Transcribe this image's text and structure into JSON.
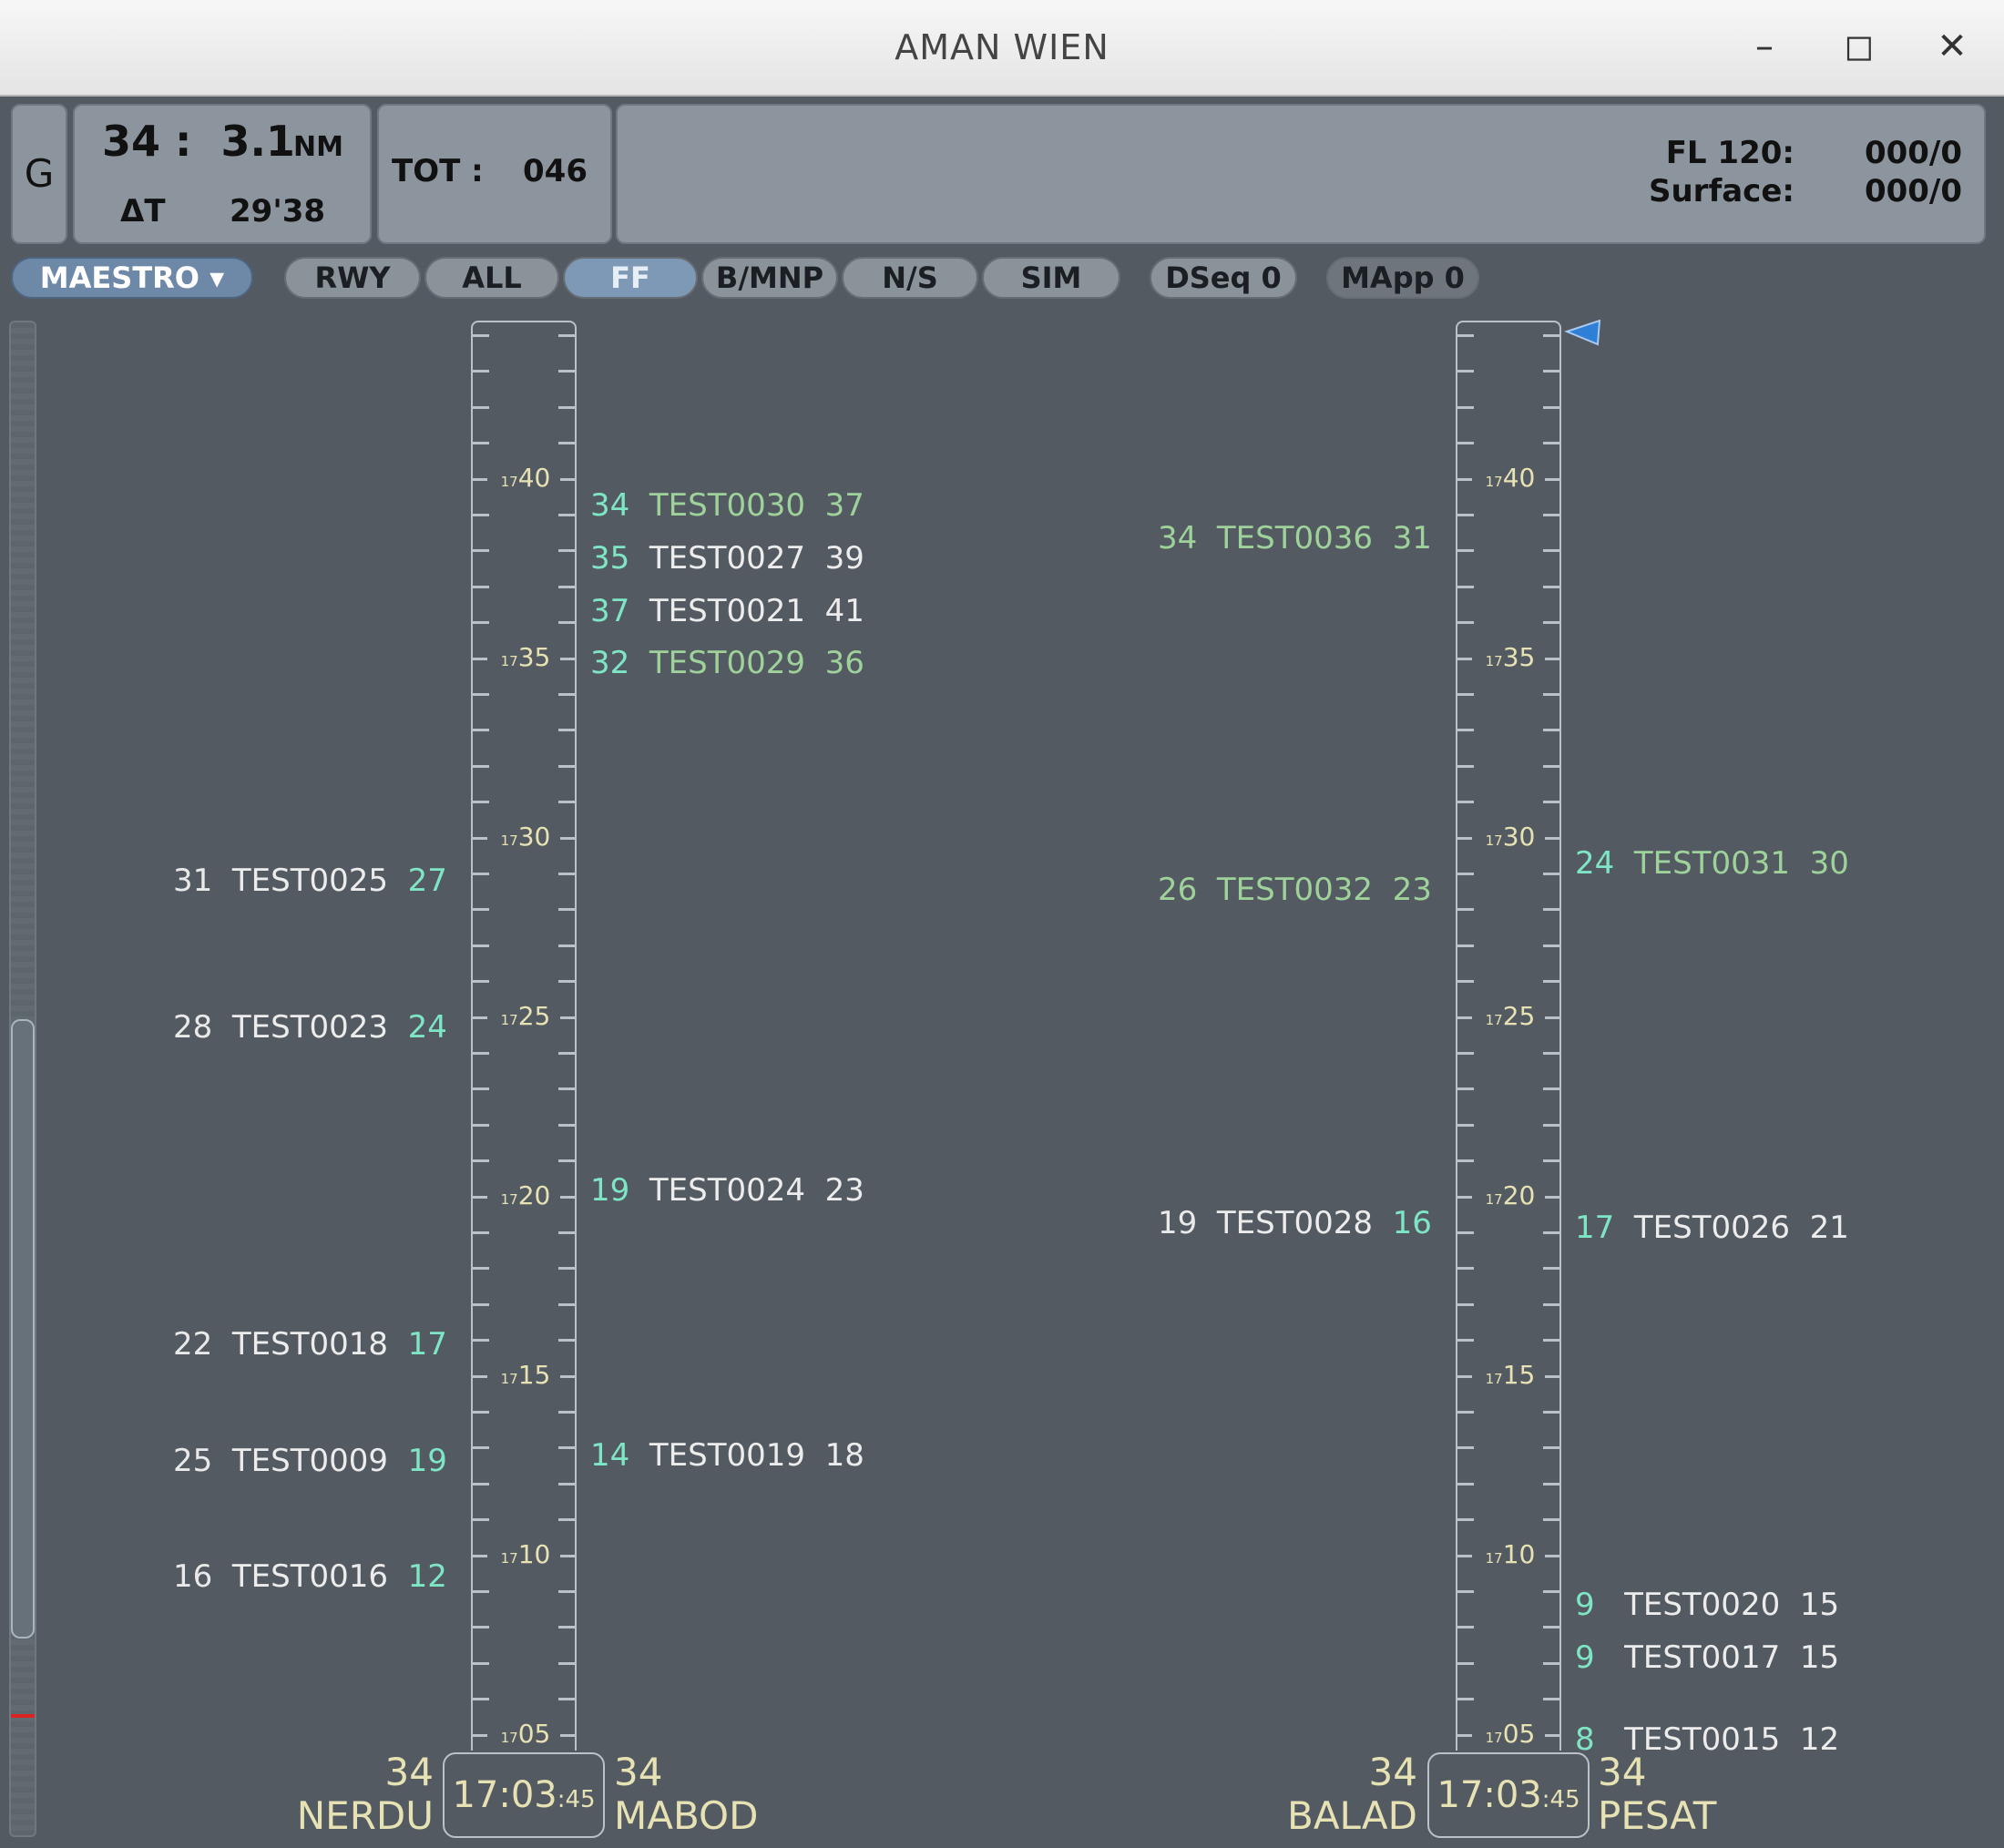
{
  "window": {
    "title": "AMAN WIEN",
    "minimize": "–",
    "maximize": "◻",
    "close": "✕"
  },
  "header": {
    "g_label": "G",
    "distance": {
      "value": "34 :  3.1",
      "unit": "NM"
    },
    "delta": {
      "label": "ΔT",
      "value": "29'38"
    },
    "tot": {
      "label": "TOT :",
      "value": "046"
    },
    "fl": {
      "label": "FL 120:",
      "value": "000/0"
    },
    "surface": {
      "label": "Surface:",
      "value": "000/0"
    }
  },
  "toolbar": {
    "maestro": "MAESTRO ▾",
    "buttons": [
      "RWY",
      "ALL",
      "FF",
      "B/MNP",
      "N/S",
      "SIM"
    ],
    "dseq": "DSeq 0",
    "mapp": "MApp 0"
  },
  "timeline_labels": {
    "minutes": [
      "40",
      "35",
      "30",
      "25",
      "20",
      "15",
      "10",
      "05"
    ],
    "hour": "17"
  },
  "columns": [
    {
      "left_rwy": "34",
      "left_fix": "NERDU",
      "time": "17:03",
      "seconds": ":45",
      "right_rwy": "34",
      "right_fix": "MABOD"
    },
    {
      "left_rwy": "34",
      "left_fix": "BALAD",
      "time": "17:03",
      "seconds": ":45",
      "right_rwy": "34",
      "right_fix": "PESAT"
    }
  ],
  "flights": [
    {
      "callsign": "TEST0025",
      "pre": "31",
      "post": "27",
      "colors": [
        "#e9e9e9",
        "#ececec",
        "#7ee6c4"
      ]
    },
    {
      "callsign": "TEST0023",
      "pre": "28",
      "post": "24",
      "colors": [
        "#e9e9e9",
        "#ececec",
        "#7ee6c4"
      ]
    },
    {
      "callsign": "TEST0018",
      "pre": "22",
      "post": "17",
      "colors": [
        "#e9e9e9",
        "#ececec",
        "#7ee6c4"
      ]
    },
    {
      "callsign": "TEST0009",
      "pre": "25",
      "post": "19",
      "colors": [
        "#e9e9e9",
        "#ececec",
        "#7ee6c4"
      ]
    },
    {
      "callsign": "TEST0016",
      "pre": "16",
      "post": "12",
      "colors": [
        "#e9e9e9",
        "#ececec",
        "#7ee6c4"
      ]
    },
    {
      "callsign": "TEST0030",
      "pre": "34",
      "post": "37",
      "colors": [
        "#7ee6c4",
        "#9ed29a",
        "#9ed29a"
      ]
    },
    {
      "callsign": "TEST0027",
      "pre": "35",
      "post": "39",
      "colors": [
        "#7ee6c4",
        "#ececec",
        "#ececec"
      ]
    },
    {
      "callsign": "TEST0021",
      "pre": "37",
      "post": "41",
      "colors": [
        "#7ee6c4",
        "#ececec",
        "#ececec"
      ]
    },
    {
      "callsign": "TEST0029",
      "pre": "32",
      "post": "36",
      "colors": [
        "#7ee6c4",
        "#9ed29a",
        "#9ed29a"
      ]
    },
    {
      "callsign": "TEST0024",
      "pre": "19",
      "post": "23",
      "colors": [
        "#7ee6c4",
        "#ececec",
        "#ececec"
      ]
    },
    {
      "callsign": "TEST0019",
      "pre": "14",
      "post": "18",
      "colors": [
        "#7ee6c4",
        "#ececec",
        "#ececec"
      ]
    },
    {
      "callsign": "TEST0036",
      "pre": "34",
      "post": "31",
      "colors": [
        "#9ed29a",
        "#9ed29a",
        "#9ed29a"
      ]
    },
    {
      "callsign": "TEST0032",
      "pre": "26",
      "post": "23",
      "colors": [
        "#9ed29a",
        "#9ed29a",
        "#9ed29a"
      ]
    },
    {
      "callsign": "TEST0028",
      "pre": "19",
      "post": "16",
      "colors": [
        "#e9e9e9",
        "#ececec",
        "#7ee6c4"
      ]
    },
    {
      "callsign": "TEST0031",
      "pre": "24",
      "post": "30",
      "colors": [
        "#7ee6c4",
        "#9ed29a",
        "#9ed29a"
      ]
    },
    {
      "callsign": "TEST0026",
      "pre": "17",
      "post": "21",
      "colors": [
        "#7ee6c4",
        "#ececec",
        "#ececec"
      ]
    },
    {
      "callsign": "TEST0020",
      "pre": "9",
      "post": "15",
      "colors": [
        "#7ee6c4",
        "#ececec",
        "#ececec"
      ]
    },
    {
      "callsign": "TEST0017",
      "pre": "9",
      "post": "15",
      "colors": [
        "#7ee6c4",
        "#ececec",
        "#ececec"
      ]
    },
    {
      "callsign": "TEST0015",
      "pre": "8",
      "post": "12",
      "colors": [
        "#7ee6c4",
        "#ececec",
        "#ececec"
      ]
    }
  ]
}
